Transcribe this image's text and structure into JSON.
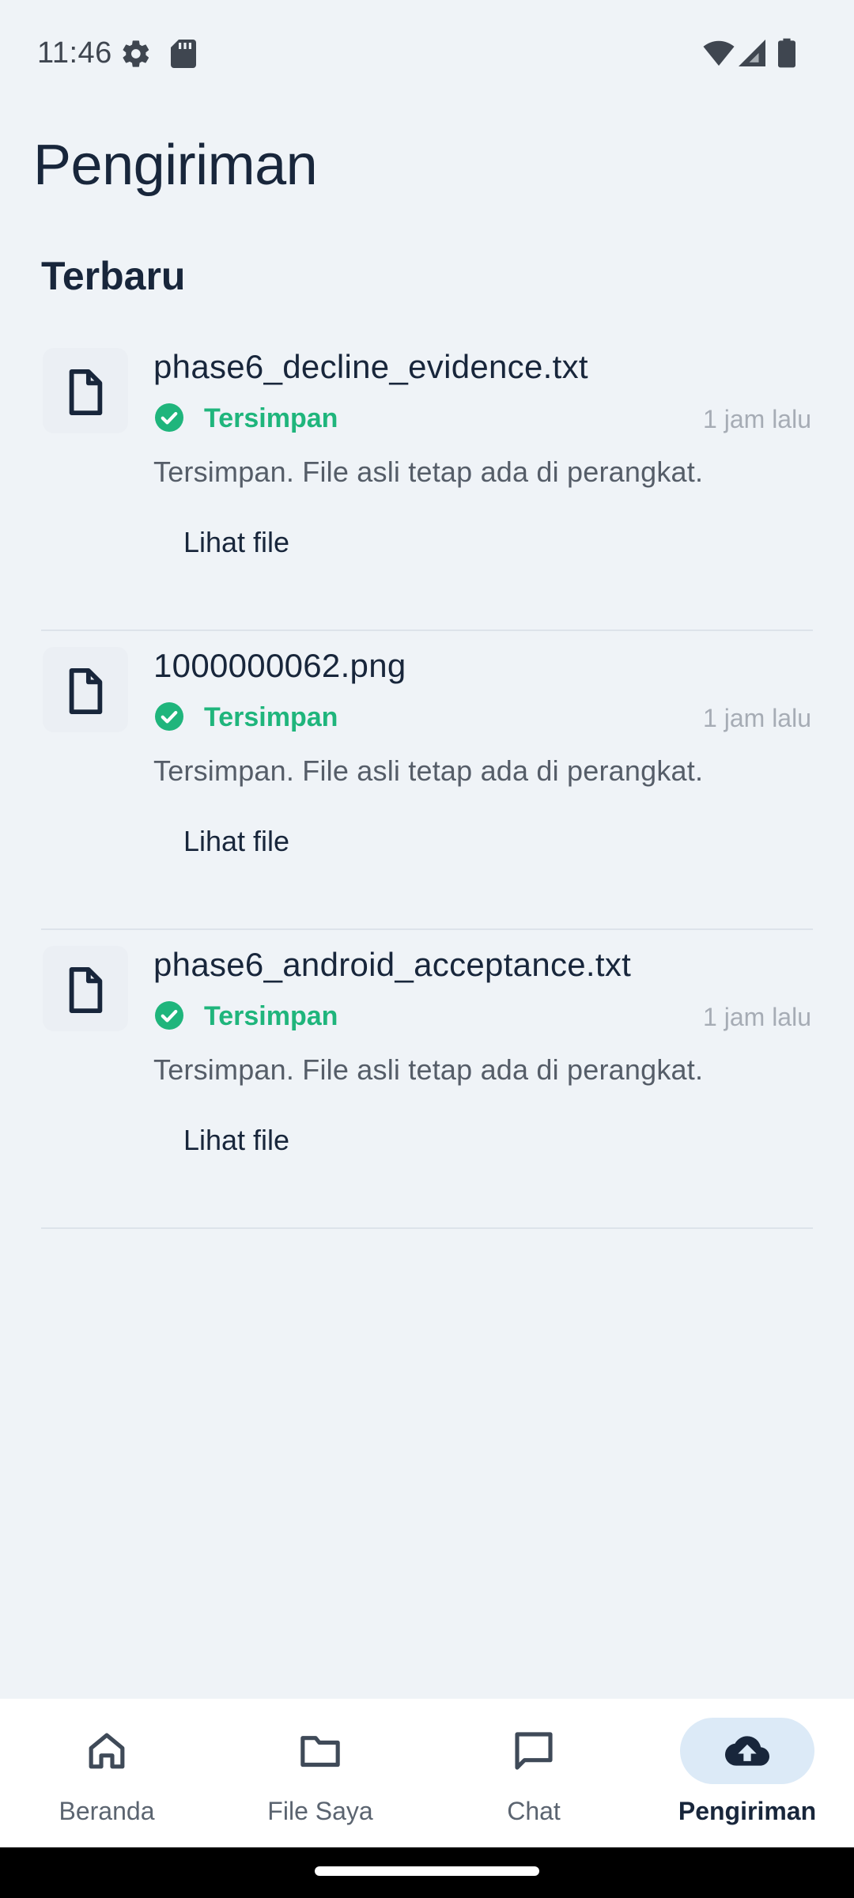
{
  "status_bar": {
    "time": "11:46",
    "icons": [
      "gear-icon",
      "sd-card-icon",
      "wifi-icon",
      "signal-icon",
      "battery-icon"
    ]
  },
  "header": {
    "title": "Pengiriman",
    "section": "Terbaru"
  },
  "uploads": [
    {
      "file_name": "phase6_decline_evidence.txt",
      "status": "Tersimpan",
      "time_ago": "1 jam lalu",
      "description": "Tersimpan. File asli tetap ada di perangkat.",
      "action_label": "Lihat file"
    },
    {
      "file_name": "1000000062.png",
      "status": "Tersimpan",
      "time_ago": "1 jam lalu",
      "description": "Tersimpan. File asli tetap ada di perangkat.",
      "action_label": "Lihat file"
    },
    {
      "file_name": "phase6_android_acceptance.txt",
      "status": "Tersimpan",
      "time_ago": "1 jam lalu",
      "description": "Tersimpan. File asli tetap ada di perangkat.",
      "action_label": "Lihat file"
    }
  ],
  "bottom_nav": {
    "items": [
      {
        "label": "Beranda",
        "icon": "home-icon",
        "active": false
      },
      {
        "label": "File Saya",
        "icon": "folder-icon",
        "active": false
      },
      {
        "label": "Chat",
        "icon": "chat-icon",
        "active": false
      },
      {
        "label": "Pengiriman",
        "icon": "cloud-upload-icon",
        "active": true
      }
    ]
  },
  "colors": {
    "background": "#eff3f7",
    "primary_text": "#18263b",
    "success": "#1fb57c",
    "muted": "#a6acb5",
    "active_pill": "#dceaf7"
  }
}
